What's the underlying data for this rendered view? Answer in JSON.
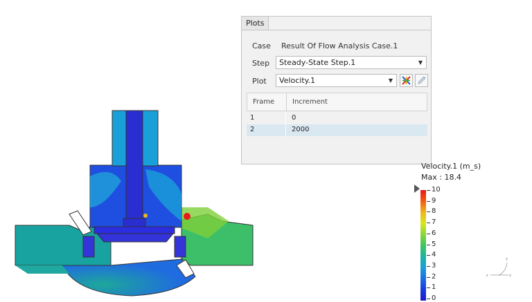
{
  "panel": {
    "tab": "Plots",
    "case_label": "Case",
    "case_value": "Result Of Flow Analysis Case.1",
    "step_label": "Step",
    "step_value": "Steady-State Step.1",
    "plot_label": "Plot",
    "plot_value": "Velocity.1",
    "table": {
      "headers": [
        "Frame",
        "Increment"
      ],
      "rows": [
        {
          "frame": "1",
          "increment": "0",
          "selected": false
        },
        {
          "frame": "2",
          "increment": "2000",
          "selected": true
        }
      ]
    }
  },
  "legend": {
    "title": "Velocity.1 (m_s)",
    "max": "Max : 18.4",
    "ticks": [
      "10",
      "9",
      "8",
      "7",
      "6",
      "5",
      "4",
      "3",
      "2",
      "1",
      "0"
    ],
    "colors": [
      "#e81a1a",
      "#f0b41e",
      "#8dd63b",
      "#1fb5a0",
      "#1b6ee3",
      "#1d18c8"
    ]
  },
  "axis_triad": {
    "x": "x",
    "y": "y",
    "z": "z"
  },
  "icons": {
    "plot_settings": "plot-settings-icon",
    "edit": "edit-pencil-icon"
  }
}
